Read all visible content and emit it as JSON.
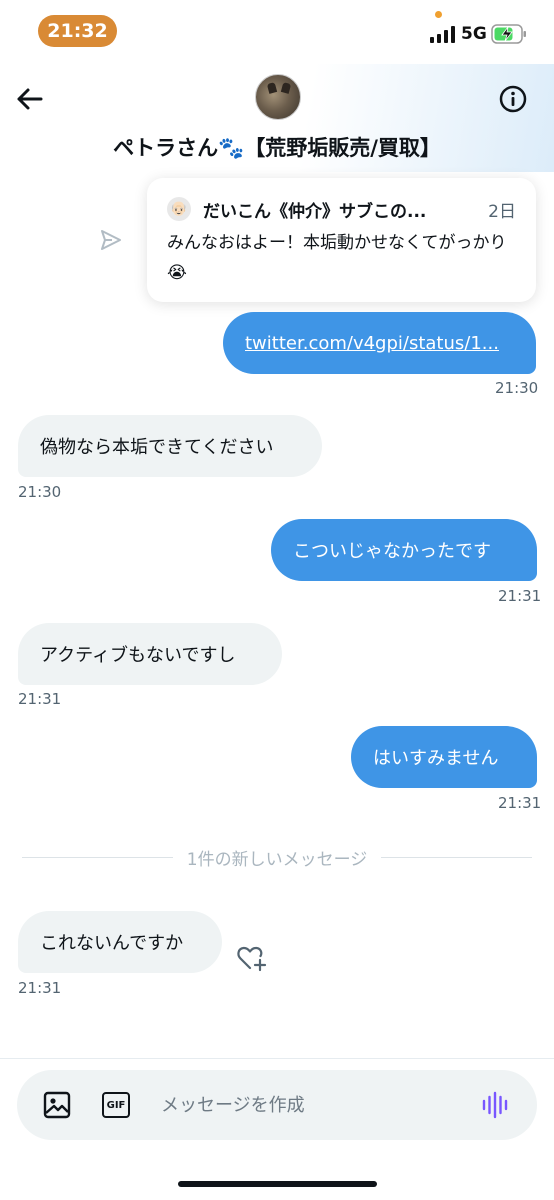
{
  "status_bar": {
    "time": "21:32",
    "network": "5G"
  },
  "header": {
    "title": "ペトラさん🐾【荒野垢販売/買取】"
  },
  "shared_tweet": {
    "author_emoji": "👴🏻",
    "author": "だいこん《仲介》サブこの...",
    "age": "2日",
    "text": "みんなおはよー！本垢動かせなくてがっかり😭"
  },
  "messages": [
    {
      "side": "sent",
      "text": "twitter.com/v4gpi/status/1...",
      "time": "21:30"
    },
    {
      "side": "received",
      "text": "偽物なら本垢できてください",
      "time": "21:30"
    },
    {
      "side": "sent",
      "text": "こついじゃなかったです",
      "time": "21:31"
    },
    {
      "side": "received",
      "text": "アクティブもないですし",
      "time": "21:31"
    },
    {
      "side": "sent",
      "text": "はいすみません",
      "time": "21:31"
    },
    {
      "side": "received",
      "text": "これないんですか",
      "time": "21:31"
    }
  ],
  "new_messages_divider": "1件の新しいメッセージ",
  "composer": {
    "placeholder": "メッセージを作成",
    "gif_label": "GIF"
  },
  "colors": {
    "sent_bubble": "#3f95e6",
    "received_bubble": "#eff3f4",
    "accent_voice": "#7856ff",
    "time_pill": "#d98a35"
  },
  "icons": [
    "back-arrow-icon",
    "info-icon",
    "share-icon",
    "heart-plus-icon",
    "image-icon",
    "gif-icon",
    "voice-wave-icon"
  ]
}
